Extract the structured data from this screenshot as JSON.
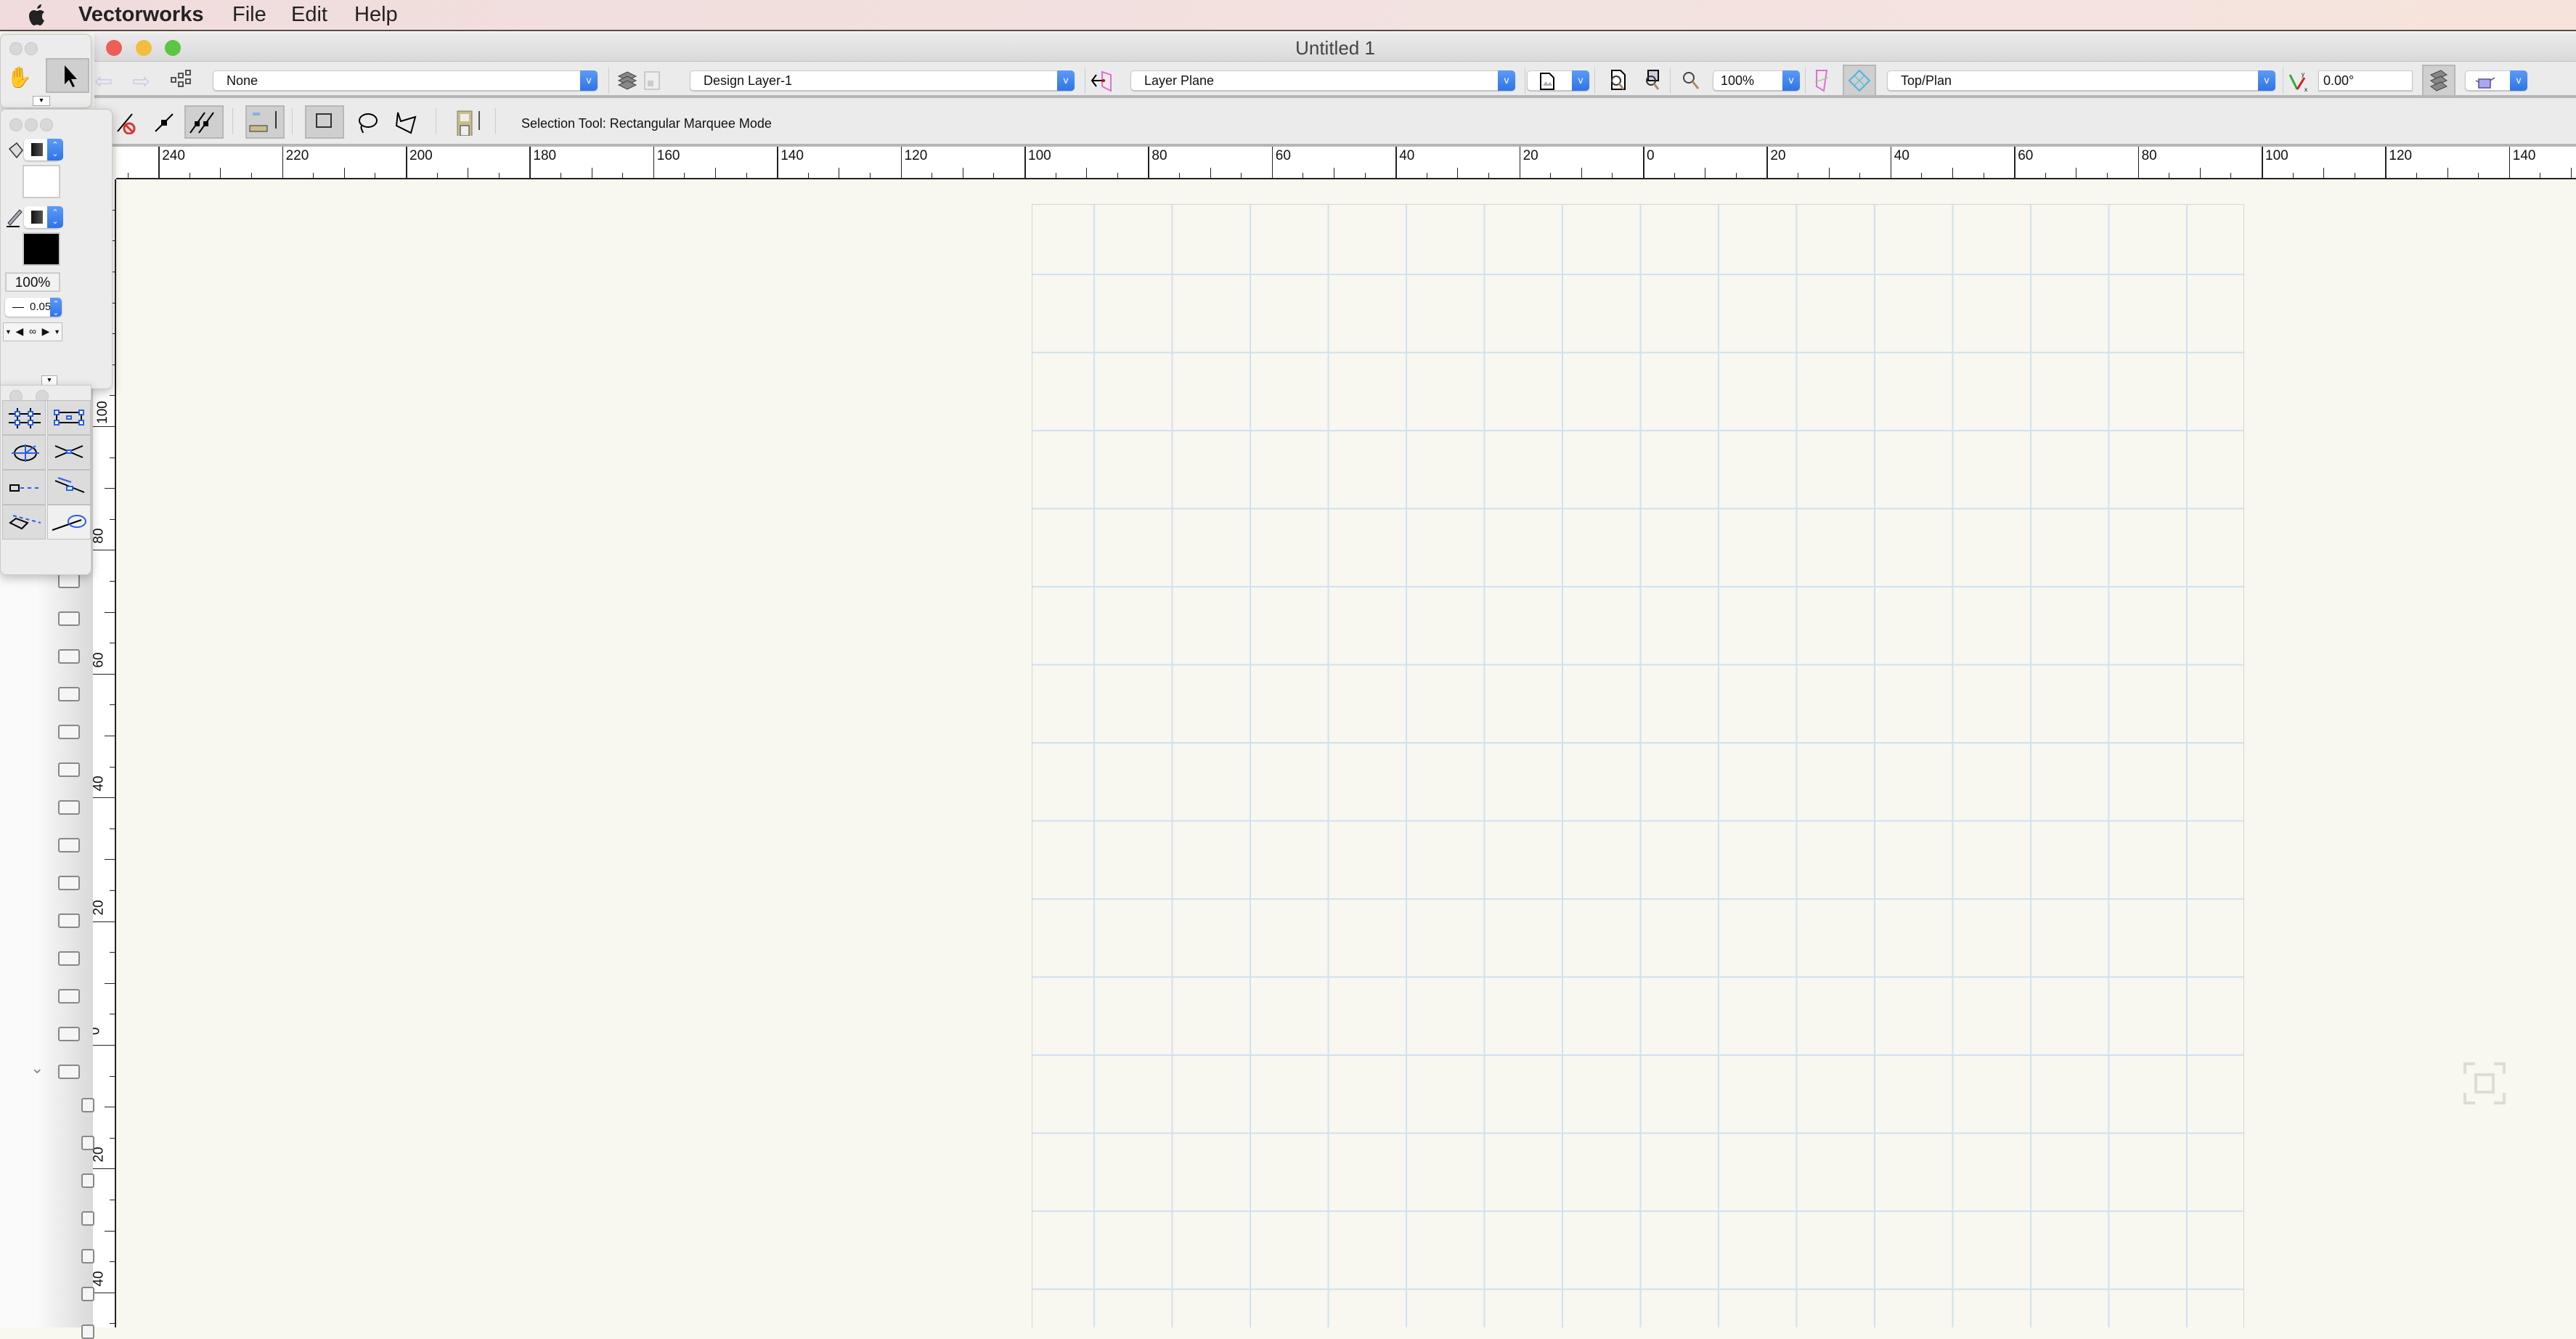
{
  "menubar": {
    "app": "Vectorworks",
    "items": [
      "File",
      "Edit",
      "Help"
    ]
  },
  "window": {
    "title": "Untitled 1"
  },
  "toolbar": {
    "class_value": "None",
    "layer_value": "Design Layer-1",
    "plane_value": "Layer Plane",
    "zoom_value": "100%",
    "view_value": "Top/Plan",
    "rotation_value": "0.00°"
  },
  "modebar": {
    "status": "Selection Tool: Rectangular Marquee Mode"
  },
  "attributes": {
    "opacity": "100%",
    "line_thickness": "0.05"
  },
  "hruler": {
    "labels": [
      {
        "text": "240",
        "v": -240
      },
      {
        "text": "220",
        "v": -220
      },
      {
        "text": "200",
        "v": -200
      },
      {
        "text": "180",
        "v": -180
      },
      {
        "text": "160",
        "v": -160
      },
      {
        "text": "140",
        "v": -140
      },
      {
        "text": "120",
        "v": -120
      },
      {
        "text": "100",
        "v": -100
      },
      {
        "text": "80",
        "v": -80
      },
      {
        "text": "60",
        "v": -60
      },
      {
        "text": "40",
        "v": -40
      },
      {
        "text": "20",
        "v": -20
      },
      {
        "text": "0",
        "v": 0
      },
      {
        "text": "20",
        "v": 20
      },
      {
        "text": "40",
        "v": 40
      },
      {
        "text": "60",
        "v": 60
      },
      {
        "text": "80",
        "v": 80
      },
      {
        "text": "100",
        "v": 100
      },
      {
        "text": "120",
        "v": 120
      },
      {
        "text": "140",
        "v": 140
      }
    ]
  },
  "vruler": {
    "labels": [
      {
        "text": "100",
        "v": 100
      },
      {
        "text": "80",
        "v": 80
      },
      {
        "text": "60",
        "v": 60
      },
      {
        "text": "40",
        "v": 40
      },
      {
        "text": "20",
        "v": 20
      },
      {
        "text": "0",
        "v": 0
      },
      {
        "text": "20",
        "v": -20
      },
      {
        "text": "40",
        "v": -40
      }
    ]
  }
}
